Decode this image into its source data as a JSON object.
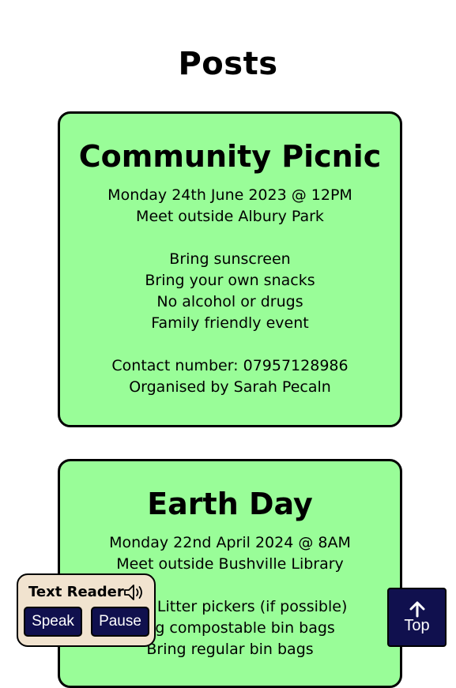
{
  "page": {
    "title": "Posts"
  },
  "posts": [
    {
      "title": "Community Picnic",
      "lines": [
        "Monday 24th June 2023 @ 12PM",
        "Meet outside Albury Park",
        "",
        "Bring sunscreen",
        "Bring your own snacks",
        "No alcohol or drugs",
        "Family friendly event",
        "",
        "Contact number: 07957128986",
        "Organised by Sarah Pecaln"
      ]
    },
    {
      "title": "Earth Day",
      "lines": [
        "Monday 22nd April 2024 @ 8AM",
        "Meet outside Bushville Library",
        "",
        "Bring Litter pickers (if possible)",
        "Bring compostable bin bags",
        "Bring regular bin bags"
      ]
    }
  ],
  "text_reader": {
    "title": "Text Reader",
    "icon": "speaker-icon",
    "speak_label": "Speak",
    "pause_label": "Pause"
  },
  "top_button": {
    "label": "Top",
    "icon": "arrow-up-icon"
  },
  "colors": {
    "card_background": "#99fd98",
    "button_background": "#10104e",
    "reader_background": "#f1e3cf"
  }
}
